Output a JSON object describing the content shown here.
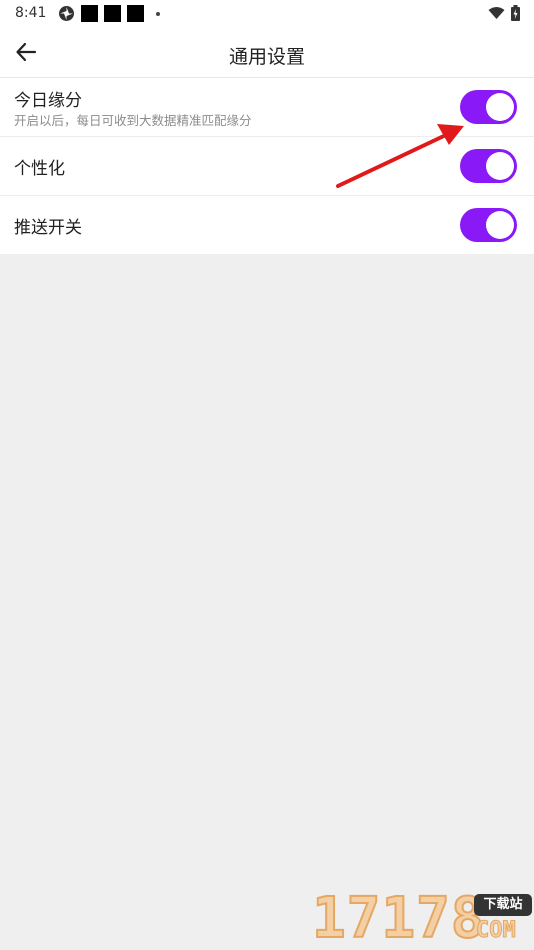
{
  "status_bar": {
    "time": "8:41"
  },
  "header": {
    "title": "通用设置",
    "back_icon": "arrow-left-icon"
  },
  "settings": [
    {
      "label": "今日缘分",
      "description": "开启以后，每日可收到大数据精准匹配缘分",
      "enabled": true
    },
    {
      "label": "个性化",
      "enabled": true
    },
    {
      "label": "推送开关",
      "enabled": true
    }
  ],
  "colors": {
    "toggle_on": "#8a19f7",
    "annotation_arrow": "#e0191b"
  },
  "watermark": {
    "digits": "17178",
    "badge": "下载站",
    "suffix": "COM"
  }
}
